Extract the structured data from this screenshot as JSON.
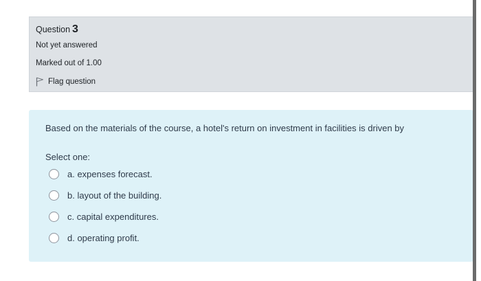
{
  "question_info": {
    "label": "Question",
    "number": "3",
    "state": "Not yet answered",
    "grade": "Marked out of 1.00",
    "flag_label": "Flag question"
  },
  "question": {
    "text": "Based on the materials of the course, a hotel's return on investment in facilities is driven by",
    "prompt": "Select one:",
    "answers": [
      {
        "label": "a. expenses forecast."
      },
      {
        "label": "b. layout of the building."
      },
      {
        "label": "c. capital expenditures."
      },
      {
        "label": "d. operating profit."
      }
    ]
  },
  "colors": {
    "info_background": "#dee2e6",
    "content_background": "#def2f8",
    "text": "#2f3b4a"
  }
}
